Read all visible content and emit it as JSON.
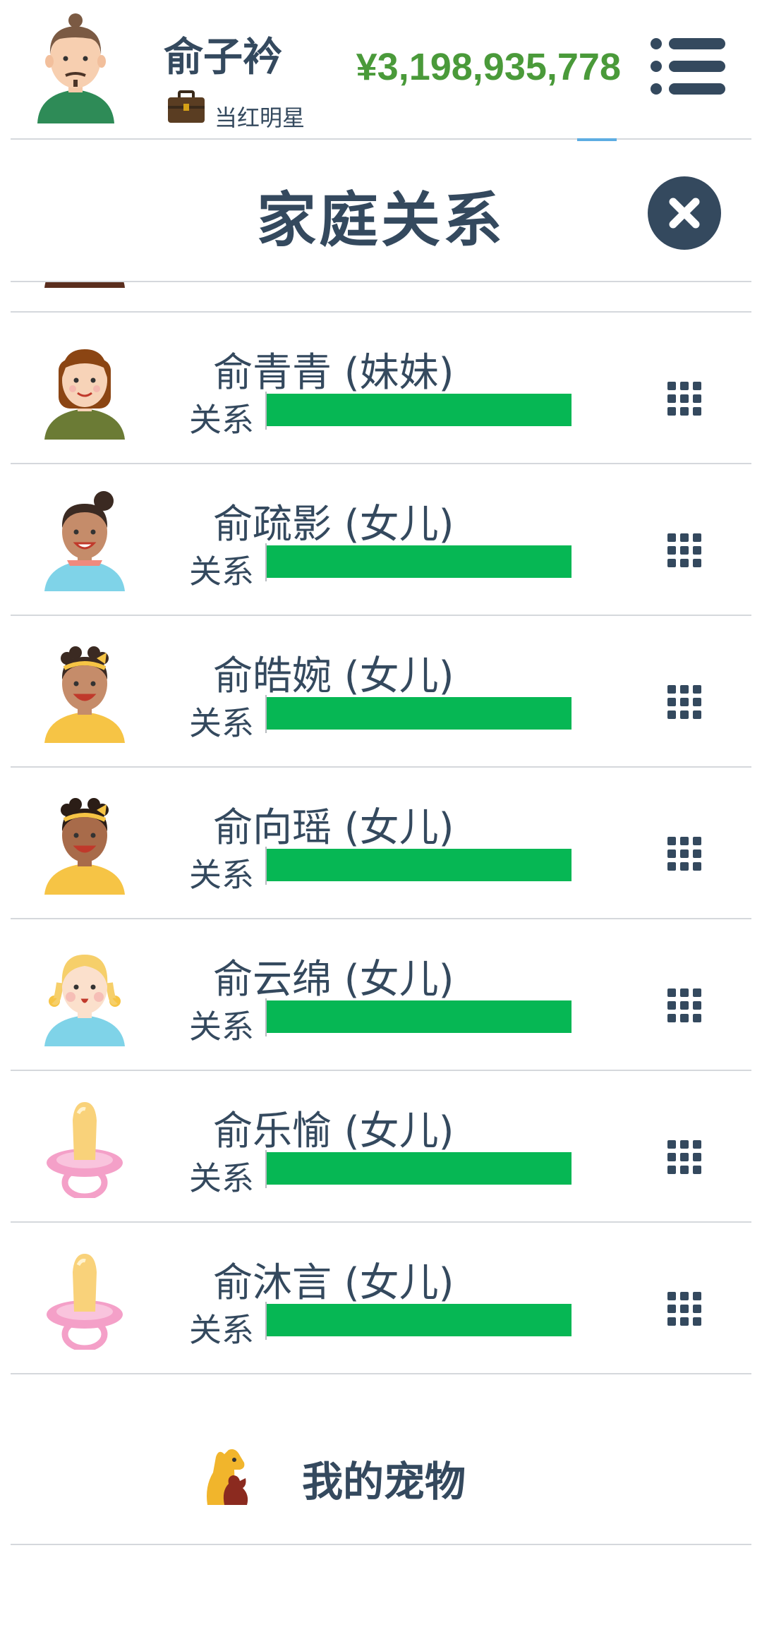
{
  "header": {
    "player_name": "俞子衿",
    "job_title": "当红明星",
    "money": "¥3,198,935,778",
    "menu_icon": "list-menu-icon",
    "briefcase_icon": "briefcase-icon"
  },
  "modal": {
    "title": "家庭关系",
    "close_icon": "close-icon"
  },
  "relationship_label": "关系",
  "members": [
    {
      "name": "",
      "avatar": "woman-avatar",
      "relationship_level": 1.0
    },
    {
      "name": "俞青青 (妹妹)",
      "avatar": "girl-bob-avatar",
      "relationship_level": 1.0
    },
    {
      "name": "俞疏影 (女儿)",
      "avatar": "girl-bun-avatar",
      "relationship_level": 1.0
    },
    {
      "name": "俞皓婉 (女儿)",
      "avatar": "girl-headband-avatar",
      "relationship_level": 1.0
    },
    {
      "name": "俞向瑶 (女儿)",
      "avatar": "girl-headband-dark-avatar",
      "relationship_level": 1.0
    },
    {
      "name": "俞云绵 (女儿)",
      "avatar": "blonde-child-avatar",
      "relationship_level": 1.0
    },
    {
      "name": "俞乐愉 (女儿)",
      "avatar": "pacifier-icon",
      "relationship_level": 1.0
    },
    {
      "name": "俞沐言 (女儿)",
      "avatar": "pacifier-icon",
      "relationship_level": 1.0
    }
  ],
  "pets": {
    "label": "我的宠物",
    "icon": "pets-icon"
  },
  "colors": {
    "text": "#34495e",
    "money": "#4a9a3a",
    "bar": "#06b754",
    "divider": "#d5d8dc",
    "tab_indicator": "#5dade2"
  }
}
